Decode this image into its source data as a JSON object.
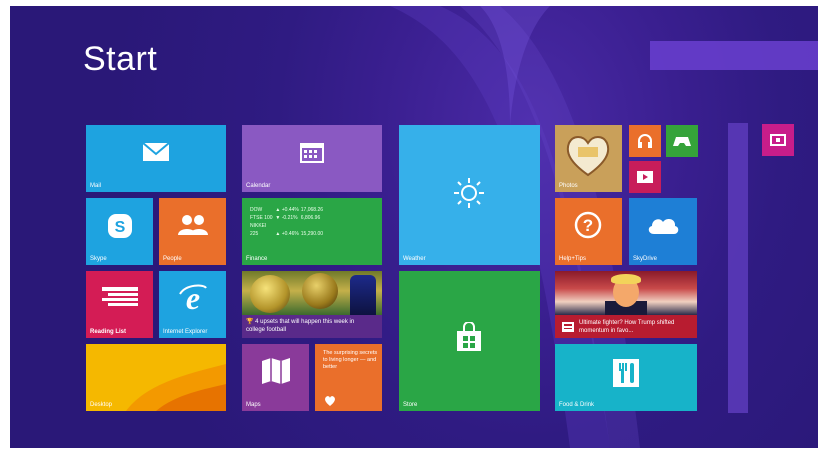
{
  "screen": {
    "title": "Start"
  },
  "tiles": {
    "mail": {
      "label": "Mail"
    },
    "calendar": {
      "label": "Calendar"
    },
    "weather": {
      "label": "Weather"
    },
    "photos": {
      "label": "Photos"
    },
    "skype": {
      "label": "Skype"
    },
    "people": {
      "label": "People"
    },
    "finance": {
      "label": "Finance",
      "rows": [
        {
          "sym": "DOW",
          "change": "▲ +0.44%",
          "value": "17,068.26"
        },
        {
          "sym": "FTSE 100",
          "change": "▼ -0.21%",
          "value": "6,806.96"
        },
        {
          "sym": "NIKKEI 225",
          "change": "▲ +0.46%",
          "value": "15,290.00"
        }
      ]
    },
    "help": {
      "label": "Help+Tips"
    },
    "onedrive": {
      "label": "SkyDrive"
    },
    "reading": {
      "label": "Reading List"
    },
    "ie": {
      "label": "Internet Explorer"
    },
    "sports": {
      "caption": "4 upsets that will happen this week in college football"
    },
    "store": {
      "label": "Store"
    },
    "news": {
      "caption": "Ultimate fighter? How Trump shifted momentum in favo..."
    },
    "desktop": {
      "label": "Desktop"
    },
    "maps": {
      "label": "Maps"
    },
    "health": {
      "caption": "The surprising secrets to living longer — and better"
    },
    "food": {
      "label": "Food & Drink"
    }
  },
  "colors": {
    "background": "#2f1b82",
    "blue": "#1ea3e0",
    "orange": "#ea6f2b",
    "green": "#2aa646",
    "purple": "#8a59c2",
    "magenta": "#d41c55",
    "yellow": "#f5b800",
    "teal": "#17b3c9"
  }
}
